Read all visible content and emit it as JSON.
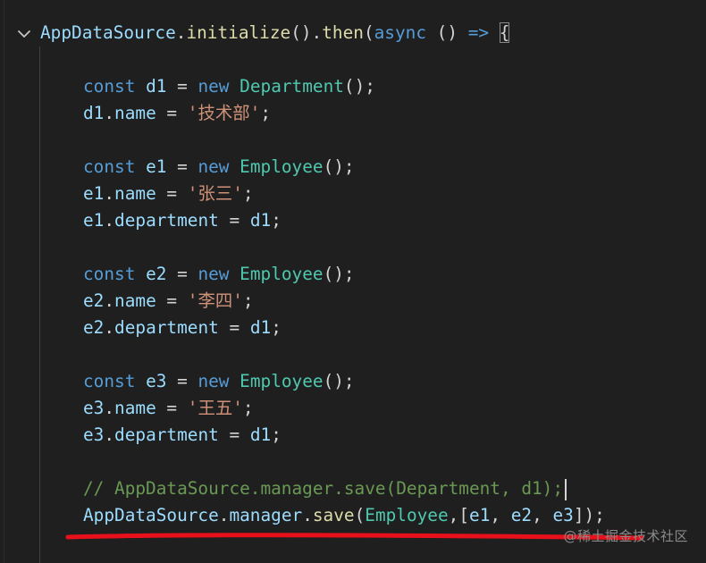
{
  "code": {
    "line_1": {
      "a": "AppDataSource",
      "b": ".",
      "c": "initialize",
      "d": "().",
      "e": "then",
      "f": "(",
      "g": "async",
      "h": " () ",
      "i": "=>",
      "j": " ",
      "k": "{"
    },
    "d1_decl": {
      "kw": "const",
      "var": "d1",
      "eq": " = ",
      "new": "new",
      "cls": "Department",
      "end": "();"
    },
    "d1_name": {
      "obj": "d1",
      "dot": ".",
      "prop": "name",
      "eq": " = ",
      "str": "'技术部'",
      "end": ";"
    },
    "e1_decl": {
      "kw": "const",
      "var": "e1",
      "eq": " = ",
      "new": "new",
      "cls": "Employee",
      "end": "();"
    },
    "e1_name": {
      "obj": "e1",
      "dot": ".",
      "prop": "name",
      "eq": " = ",
      "str": "'张三'",
      "end": ";"
    },
    "e1_dept": {
      "obj": "e1",
      "dot": ".",
      "prop": "department",
      "eq": " = ",
      "val": "d1",
      "end": ";"
    },
    "e2_decl": {
      "kw": "const",
      "var": "e2",
      "eq": " = ",
      "new": "new",
      "cls": "Employee",
      "end": "();"
    },
    "e2_name": {
      "obj": "e2",
      "dot": ".",
      "prop": "name",
      "eq": " = ",
      "str": "'李四'",
      "end": ";"
    },
    "e2_dept": {
      "obj": "e2",
      "dot": ".",
      "prop": "department",
      "eq": " = ",
      "val": "d1",
      "end": ";"
    },
    "e3_decl": {
      "kw": "const",
      "var": "e3",
      "eq": " = ",
      "new": "new",
      "cls": "Employee",
      "end": "();"
    },
    "e3_name": {
      "obj": "e3",
      "dot": ".",
      "prop": "name",
      "eq": " = ",
      "str": "'王五'",
      "end": ";"
    },
    "e3_dept": {
      "obj": "e3",
      "dot": ".",
      "prop": "department",
      "eq": " = ",
      "val": "d1",
      "end": ";"
    },
    "comment": "// AppDataSource.manager.save(Department, d1);",
    "save_call": {
      "obj": "AppDataSource",
      "dot1": ".",
      "mgr": "manager",
      "dot2": ".",
      "fn": "save",
      "open": "(",
      "cls": "Employee",
      "comma1": ",[",
      "a1": "e1",
      "comma2": ", ",
      "a2": "e2",
      "comma3": ", ",
      "a3": "e3",
      "close": "]);"
    }
  },
  "watermark": "@稀土掘金技术社区",
  "colors": {
    "background": "#1f1f1f",
    "keyword": "#569cd6",
    "function": "#dcdcaa",
    "class": "#4ec9b0",
    "variable": "#9cdcfe",
    "string": "#ce9178",
    "comment": "#6a9955",
    "underline": "#e8101a"
  }
}
